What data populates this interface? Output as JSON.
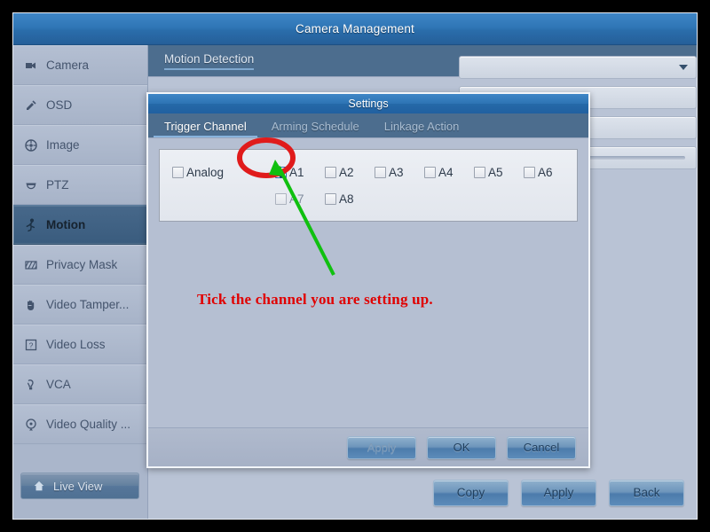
{
  "window": {
    "title": "Camera Management"
  },
  "sidebar": {
    "items": [
      {
        "label": "Camera",
        "icon": "camera-icon",
        "active": false
      },
      {
        "label": "OSD",
        "icon": "osd-icon",
        "active": false
      },
      {
        "label": "Image",
        "icon": "image-icon",
        "active": false
      },
      {
        "label": "PTZ",
        "icon": "ptz-icon",
        "active": false
      },
      {
        "label": "Motion",
        "icon": "motion-icon",
        "active": true
      },
      {
        "label": "Privacy Mask",
        "icon": "privacy-mask-icon",
        "active": false
      },
      {
        "label": "Video Tamper...",
        "icon": "video-tamper-icon",
        "active": false
      },
      {
        "label": "Video Loss",
        "icon": "video-loss-icon",
        "active": false
      },
      {
        "label": "VCA",
        "icon": "vca-icon",
        "active": false
      },
      {
        "label": "Video Quality ...",
        "icon": "video-quality-icon",
        "active": false
      }
    ],
    "live_view": {
      "label": "Live View",
      "icon": "home-icon"
    }
  },
  "main": {
    "page_title": "Motion Detection",
    "form": {
      "dropdown_value": "",
      "field1_value": "",
      "field2_value": "",
      "slider_value": ""
    },
    "buttons": [
      {
        "label": "Copy",
        "name": "copy-button",
        "disabled": false
      },
      {
        "label": "Apply",
        "name": "apply-button",
        "disabled": false
      },
      {
        "label": "Back",
        "name": "back-button",
        "disabled": false
      }
    ]
  },
  "dialog": {
    "title": "Settings",
    "tabs": [
      {
        "label": "Trigger Channel",
        "active": true
      },
      {
        "label": "Arming Schedule",
        "active": false
      },
      {
        "label": "Linkage Action",
        "active": false
      }
    ],
    "channels": {
      "analog": {
        "label": "Analog",
        "checked": false
      },
      "row1": [
        {
          "label": "A1",
          "checked": true
        },
        {
          "label": "A2",
          "checked": false
        },
        {
          "label": "A3",
          "checked": false
        },
        {
          "label": "A4",
          "checked": false
        },
        {
          "label": "A5",
          "checked": false
        },
        {
          "label": "A6",
          "checked": false
        }
      ],
      "row2": [
        {
          "label": "A7",
          "checked": false
        },
        {
          "label": "A8",
          "checked": false
        }
      ]
    },
    "buttons": [
      {
        "label": "Apply",
        "name": "dialog-apply-button",
        "disabled": true
      },
      {
        "label": "OK",
        "name": "dialog-ok-button",
        "disabled": false
      },
      {
        "label": "Cancel",
        "name": "dialog-cancel-button",
        "disabled": false
      }
    ]
  },
  "annotations": {
    "callout_text": "Tick the channel you are setting up.",
    "callout_color": "#e00000",
    "highlight_ellipse_color": "#e01b1b",
    "arrow_color": "#10c010"
  }
}
